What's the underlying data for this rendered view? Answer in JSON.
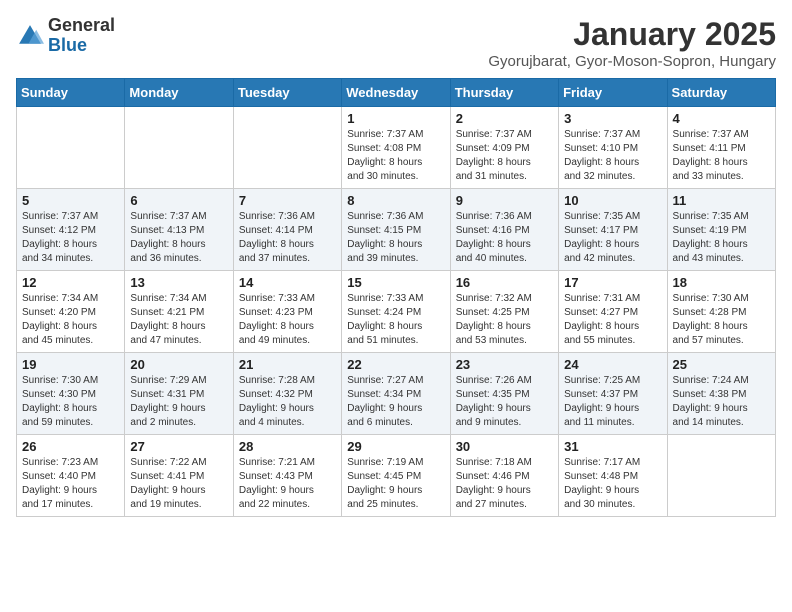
{
  "header": {
    "logo_general": "General",
    "logo_blue": "Blue",
    "month": "January 2025",
    "location": "Gyorujbarat, Gyor-Moson-Sopron, Hungary"
  },
  "days_of_week": [
    "Sunday",
    "Monday",
    "Tuesday",
    "Wednesday",
    "Thursday",
    "Friday",
    "Saturday"
  ],
  "weeks": [
    [
      {
        "day": "",
        "info": ""
      },
      {
        "day": "",
        "info": ""
      },
      {
        "day": "",
        "info": ""
      },
      {
        "day": "1",
        "info": "Sunrise: 7:37 AM\nSunset: 4:08 PM\nDaylight: 8 hours\nand 30 minutes."
      },
      {
        "day": "2",
        "info": "Sunrise: 7:37 AM\nSunset: 4:09 PM\nDaylight: 8 hours\nand 31 minutes."
      },
      {
        "day": "3",
        "info": "Sunrise: 7:37 AM\nSunset: 4:10 PM\nDaylight: 8 hours\nand 32 minutes."
      },
      {
        "day": "4",
        "info": "Sunrise: 7:37 AM\nSunset: 4:11 PM\nDaylight: 8 hours\nand 33 minutes."
      }
    ],
    [
      {
        "day": "5",
        "info": "Sunrise: 7:37 AM\nSunset: 4:12 PM\nDaylight: 8 hours\nand 34 minutes."
      },
      {
        "day": "6",
        "info": "Sunrise: 7:37 AM\nSunset: 4:13 PM\nDaylight: 8 hours\nand 36 minutes."
      },
      {
        "day": "7",
        "info": "Sunrise: 7:36 AM\nSunset: 4:14 PM\nDaylight: 8 hours\nand 37 minutes."
      },
      {
        "day": "8",
        "info": "Sunrise: 7:36 AM\nSunset: 4:15 PM\nDaylight: 8 hours\nand 39 minutes."
      },
      {
        "day": "9",
        "info": "Sunrise: 7:36 AM\nSunset: 4:16 PM\nDaylight: 8 hours\nand 40 minutes."
      },
      {
        "day": "10",
        "info": "Sunrise: 7:35 AM\nSunset: 4:17 PM\nDaylight: 8 hours\nand 42 minutes."
      },
      {
        "day": "11",
        "info": "Sunrise: 7:35 AM\nSunset: 4:19 PM\nDaylight: 8 hours\nand 43 minutes."
      }
    ],
    [
      {
        "day": "12",
        "info": "Sunrise: 7:34 AM\nSunset: 4:20 PM\nDaylight: 8 hours\nand 45 minutes."
      },
      {
        "day": "13",
        "info": "Sunrise: 7:34 AM\nSunset: 4:21 PM\nDaylight: 8 hours\nand 47 minutes."
      },
      {
        "day": "14",
        "info": "Sunrise: 7:33 AM\nSunset: 4:23 PM\nDaylight: 8 hours\nand 49 minutes."
      },
      {
        "day": "15",
        "info": "Sunrise: 7:33 AM\nSunset: 4:24 PM\nDaylight: 8 hours\nand 51 minutes."
      },
      {
        "day": "16",
        "info": "Sunrise: 7:32 AM\nSunset: 4:25 PM\nDaylight: 8 hours\nand 53 minutes."
      },
      {
        "day": "17",
        "info": "Sunrise: 7:31 AM\nSunset: 4:27 PM\nDaylight: 8 hours\nand 55 minutes."
      },
      {
        "day": "18",
        "info": "Sunrise: 7:30 AM\nSunset: 4:28 PM\nDaylight: 8 hours\nand 57 minutes."
      }
    ],
    [
      {
        "day": "19",
        "info": "Sunrise: 7:30 AM\nSunset: 4:30 PM\nDaylight: 8 hours\nand 59 minutes."
      },
      {
        "day": "20",
        "info": "Sunrise: 7:29 AM\nSunset: 4:31 PM\nDaylight: 9 hours\nand 2 minutes."
      },
      {
        "day": "21",
        "info": "Sunrise: 7:28 AM\nSunset: 4:32 PM\nDaylight: 9 hours\nand 4 minutes."
      },
      {
        "day": "22",
        "info": "Sunrise: 7:27 AM\nSunset: 4:34 PM\nDaylight: 9 hours\nand 6 minutes."
      },
      {
        "day": "23",
        "info": "Sunrise: 7:26 AM\nSunset: 4:35 PM\nDaylight: 9 hours\nand 9 minutes."
      },
      {
        "day": "24",
        "info": "Sunrise: 7:25 AM\nSunset: 4:37 PM\nDaylight: 9 hours\nand 11 minutes."
      },
      {
        "day": "25",
        "info": "Sunrise: 7:24 AM\nSunset: 4:38 PM\nDaylight: 9 hours\nand 14 minutes."
      }
    ],
    [
      {
        "day": "26",
        "info": "Sunrise: 7:23 AM\nSunset: 4:40 PM\nDaylight: 9 hours\nand 17 minutes."
      },
      {
        "day": "27",
        "info": "Sunrise: 7:22 AM\nSunset: 4:41 PM\nDaylight: 9 hours\nand 19 minutes."
      },
      {
        "day": "28",
        "info": "Sunrise: 7:21 AM\nSunset: 4:43 PM\nDaylight: 9 hours\nand 22 minutes."
      },
      {
        "day": "29",
        "info": "Sunrise: 7:19 AM\nSunset: 4:45 PM\nDaylight: 9 hours\nand 25 minutes."
      },
      {
        "day": "30",
        "info": "Sunrise: 7:18 AM\nSunset: 4:46 PM\nDaylight: 9 hours\nand 27 minutes."
      },
      {
        "day": "31",
        "info": "Sunrise: 7:17 AM\nSunset: 4:48 PM\nDaylight: 9 hours\nand 30 minutes."
      },
      {
        "day": "",
        "info": ""
      }
    ]
  ]
}
